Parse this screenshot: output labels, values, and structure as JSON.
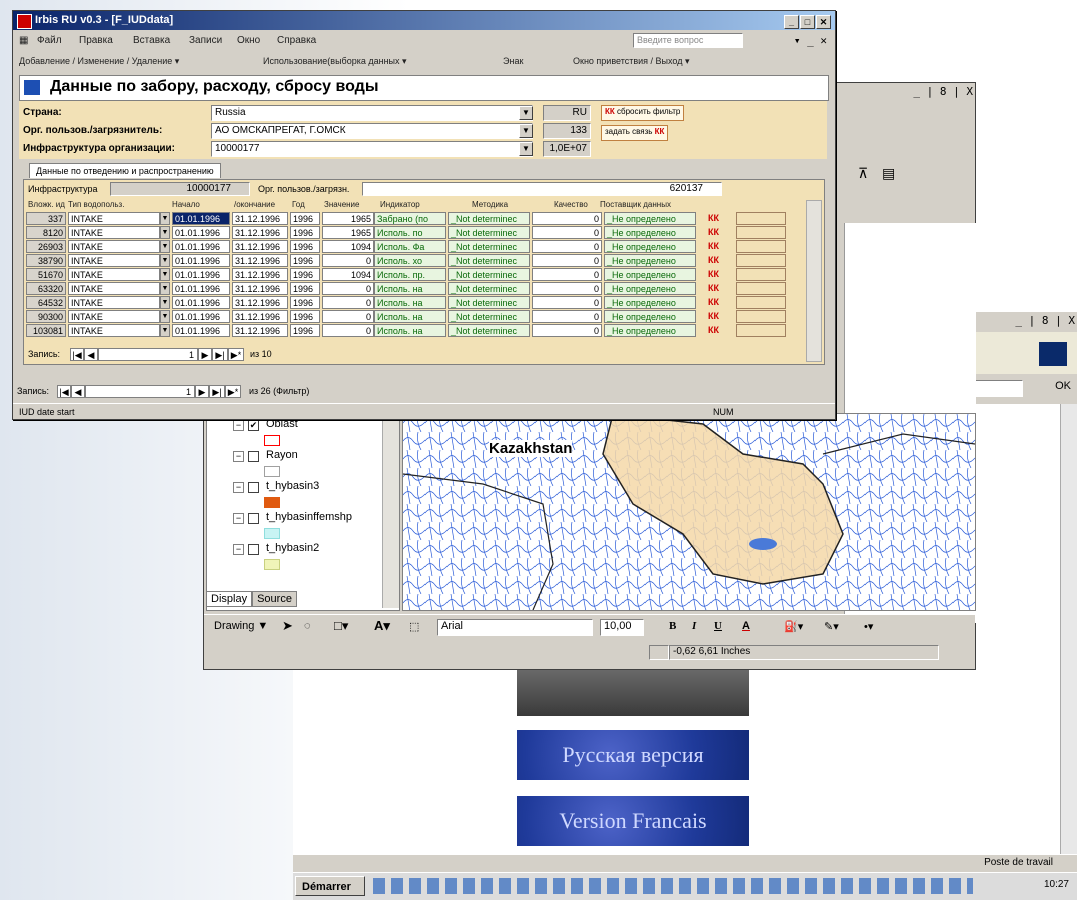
{
  "browser": {
    "controls": "_ | 8 | X",
    "go_label": "OK",
    "buttons": [
      "Русская версия",
      "Version Francais"
    ],
    "status_zone": "Poste de travail",
    "taskbar": {
      "start_label": "Démarrer",
      "clock": "10:27"
    }
  },
  "gis": {
    "controls": "_ | 8 | X",
    "toc": {
      "layers": [
        {
          "label": "Oblast",
          "checked": true,
          "swatch": "#ff0000",
          "fill": "#ffffff"
        },
        {
          "label": "Rayon",
          "checked": false,
          "swatch": "#a0a0a0",
          "fill": "#ffffff"
        },
        {
          "label": "t_hybasin3",
          "checked": false,
          "swatch": "#e05a10",
          "fill": "#e05a10"
        },
        {
          "label": "t_hybasinffemshp",
          "checked": false,
          "swatch": "#8fdede",
          "fill": "#c8f4f4"
        },
        {
          "label": "t_hybasin2",
          "checked": false,
          "swatch": "#c8d080",
          "fill": "#f0f4b8"
        }
      ],
      "tabs": [
        "Display",
        "Source"
      ]
    },
    "map_label": "Kazakhstan",
    "drawbar": {
      "drawing": "Drawing ▼",
      "font": "Arial",
      "size": "10,00",
      "bold": "B",
      "italic": "I",
      "underline": "U",
      "font_color": "A"
    },
    "coord": "-0,62  6,61 Inches"
  },
  "irbis": {
    "title": "Irbis RU v0.3 - [F_IUDdata]",
    "menu": [
      "Файл",
      "Правка",
      "Вставка",
      "Записи",
      "Окно",
      "Справка"
    ],
    "help_placeholder": "Введите вопрос",
    "toolbar": [
      "Добавление / Изменение / Удаление ▾",
      "Использование(выборка данных ▾",
      "Энак",
      "Окно приветствия / Выход ▾"
    ],
    "form_title": "Данные по забору, расходу, сбросу воды",
    "fields": [
      {
        "label": "Страна:",
        "value": "Russia",
        "code": "RU"
      },
      {
        "label": "Орг. пользов./загрязнитель:",
        "value": "АО ОМСКАПРЕГАТ, Г.ОМСК",
        "code": "133"
      },
      {
        "label": "Инфраструктура организации:",
        "value": "10000177",
        "code": "1,0E+07"
      }
    ],
    "buttons": [
      "сбросить фильтр",
      "задать связь"
    ],
    "tab_label": "Данные по отведению и распространению",
    "subform": {
      "infra_label": "Инфраструктура",
      "infra_value": "10000177",
      "org_label": "Орг. пользов./загрязн.",
      "org_value": "620137",
      "headers": [
        "Вложк. ид",
        "Тип водопольз.",
        "Начало",
        "/окончание",
        "Год",
        "Значение",
        "Индикатор",
        "Методика",
        "Качество",
        "Поставщик данных"
      ],
      "rows": [
        [
          "337",
          "INTAKE",
          "01.01.1996",
          "31.12.1996",
          "1996",
          "1965",
          "Забрано (по",
          "_Not determinec",
          "0",
          "_Не определено"
        ],
        [
          "8120",
          "INTAKE",
          "01.01.1996",
          "31.12.1996",
          "1996",
          "1965",
          "Исполь. по",
          "_Not determinec",
          "0",
          "_Не определено"
        ],
        [
          "26903",
          "INTAKE",
          "01.01.1996",
          "31.12.1996",
          "1996",
          "1094",
          "Исполь. Фа",
          "_Not determinec",
          "0",
          "_Не определено"
        ],
        [
          "38790",
          "INTAKE",
          "01.01.1996",
          "31.12.1996",
          "1996",
          "0",
          "Исполь. хо",
          "_Not determinec",
          "0",
          "_Не определено"
        ],
        [
          "51670",
          "INTAKE",
          "01.01.1996",
          "31.12.1996",
          "1996",
          "1094",
          "Исполь. пр.",
          "_Not determinec",
          "0",
          "_Не определено"
        ],
        [
          "63320",
          "INTAKE",
          "01.01.1996",
          "31.12.1996",
          "1996",
          "0",
          "Исполь. на",
          "_Not determinec",
          "0",
          "_Не определено"
        ],
        [
          "64532",
          "INTAKE",
          "01.01.1996",
          "31.12.1996",
          "1996",
          "0",
          "Исполь. на",
          "_Not determinec",
          "0",
          "_Не определено"
        ],
        [
          "90300",
          "INTAKE",
          "01.01.1996",
          "31.12.1996",
          "1996",
          "0",
          "Исполь. на",
          "_Not determinec",
          "0",
          "_Не определено"
        ],
        [
          "103081",
          "INTAKE",
          "01.01.1996",
          "31.12.1996",
          "1996",
          "0",
          "Исполь. на",
          "_Not determinec",
          "0",
          "_Не определено"
        ]
      ],
      "kk": "КК",
      "nav_label": "Запись:",
      "nav_current": "1",
      "nav_total": "из 10"
    },
    "nav_main_label": "Запись:",
    "nav_main_current": "1",
    "nav_main_total": "из 26 (Фильтр)",
    "status_left": "IUD date start",
    "status_right": "NUM"
  }
}
